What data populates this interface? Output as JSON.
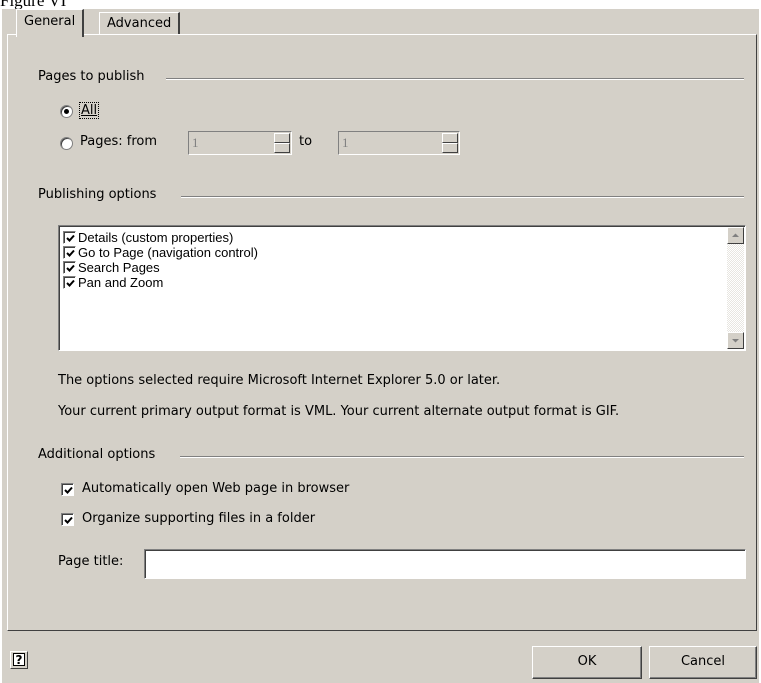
{
  "caption": "Figure VI",
  "tabs": [
    {
      "label": "General",
      "active": true
    },
    {
      "label": "Advanced",
      "active": false
    }
  ],
  "pages_to_publish": {
    "label": "Pages to publish",
    "option_all": {
      "label": "All",
      "selected": true
    },
    "option_pages": {
      "label": "Pages: from",
      "selected": false
    },
    "from_value": "1",
    "to_label": "to",
    "to_value": "1"
  },
  "publishing_options": {
    "label": "Publishing options",
    "items": [
      {
        "label": "Details (custom properties)",
        "checked": true
      },
      {
        "label": "Go to Page (navigation control)",
        "checked": true
      },
      {
        "label": "Search Pages",
        "checked": true
      },
      {
        "label": "Pan and Zoom",
        "checked": true
      }
    ],
    "note_requirement": "The options selected require Microsoft Internet Explorer 5.0 or later.",
    "note_format": "Your current primary output format is VML. Your current alternate output format is GIF."
  },
  "additional_options": {
    "label": "Additional options",
    "auto_open": {
      "label": "Automatically open Web page in browser",
      "checked": true
    },
    "organize": {
      "label": "Organize supporting files in a folder",
      "checked": true
    },
    "page_title_label": "Page title:",
    "page_title_value": ""
  },
  "footer": {
    "help_icon": "help-icon",
    "ok_label": "OK",
    "cancel_label": "Cancel"
  },
  "colors": {
    "dialog_bg": "#d4d0c8",
    "window_bg": "#ffffff"
  }
}
